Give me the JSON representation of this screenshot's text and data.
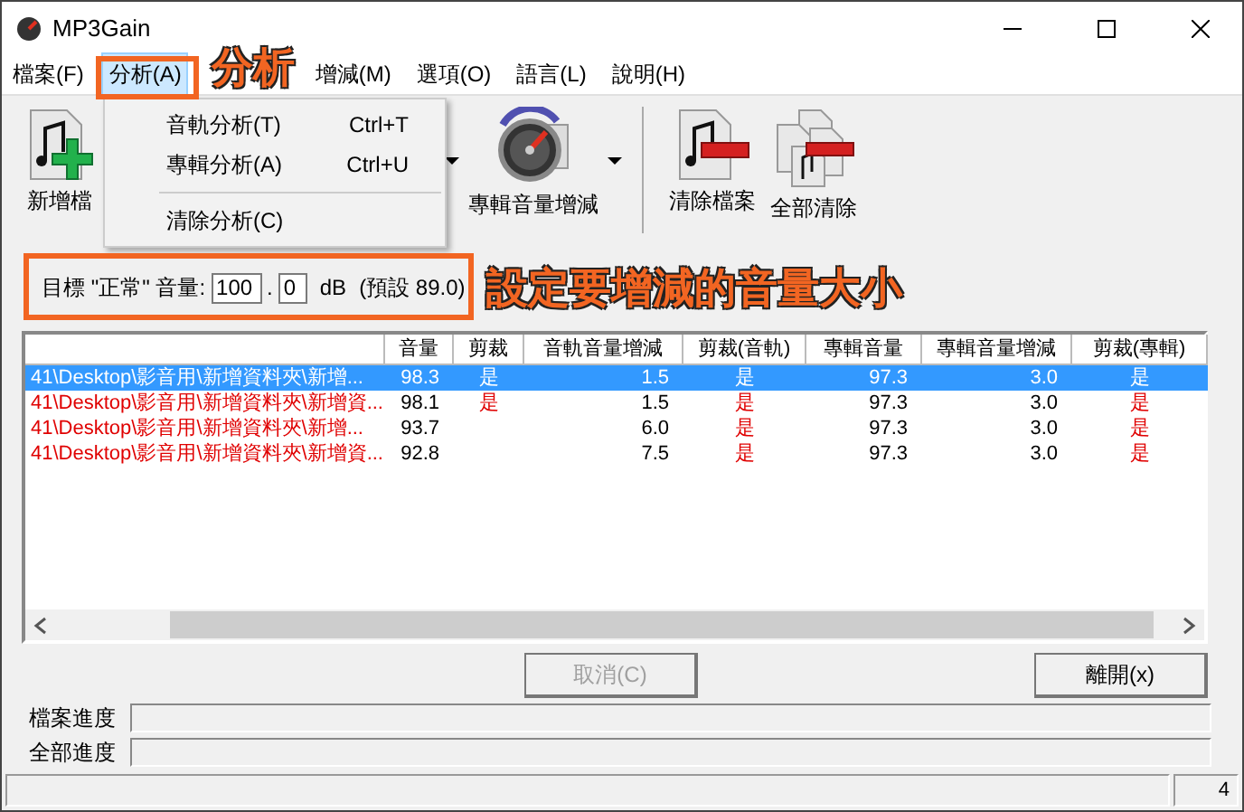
{
  "window": {
    "title": "MP3Gain"
  },
  "menu": [
    {
      "label": "檔案(F)",
      "selected": false
    },
    {
      "label": "分析(A)",
      "selected": true
    },
    {
      "label": "增減(M)",
      "selected": false
    },
    {
      "label": "選項(O)",
      "selected": false
    },
    {
      "label": "語言(L)",
      "selected": false
    },
    {
      "label": "說明(H)",
      "selected": false
    }
  ],
  "analysis_menu": [
    {
      "kind": "item",
      "label": "音軌分析(T)",
      "shortcut": "Ctrl+T"
    },
    {
      "kind": "item",
      "label": "專輯分析(A)",
      "shortcut": "Ctrl+U"
    },
    {
      "kind": "separator"
    },
    {
      "kind": "item",
      "label": "清除分析(C)"
    }
  ],
  "toolbar": [
    {
      "kind": "button",
      "label": "新增檔"
    },
    {
      "kind": "arrow"
    },
    {
      "kind": "button",
      "label": "專輯音量增減"
    },
    {
      "kind": "arrow"
    },
    {
      "kind": "separator"
    },
    {
      "kind": "button",
      "label": "清除檔案"
    },
    {
      "kind": "button",
      "label": "全部清除"
    }
  ],
  "target": {
    "label": "目標 \"正常\" 音量:",
    "integer": "100",
    "separator": ".",
    "decimal": "0",
    "unit": "dB",
    "default_note": "(預設 89.0)"
  },
  "table": {
    "columns": [
      "音量",
      "剪裁",
      "音軌音量增減",
      "剪裁(音軌)",
      "專輯音量",
      "專輯音量增減",
      "剪裁(專輯)"
    ],
    "rows": [
      {
        "selected": true,
        "path": "41\\Desktop\\影音用\\新增資料夾\\新增...",
        "volume": "98.3",
        "clip": "是",
        "track_gain": "1.5",
        "track_clip": "是",
        "album_volume": "97.3",
        "album_gain": "3.0",
        "album_clip": "是"
      },
      {
        "selected": false,
        "path": "41\\Desktop\\影音用\\新增資料夾\\新增資...",
        "volume": "98.1",
        "clip": "是",
        "track_gain": "1.5",
        "track_clip": "是",
        "album_volume": "97.3",
        "album_gain": "3.0",
        "album_clip": "是"
      },
      {
        "selected": false,
        "path": "41\\Desktop\\影音用\\新增資料夾\\新增...",
        "volume": "93.7",
        "track_gain": "6.0",
        "track_clip": "是",
        "album_volume": "97.3",
        "album_gain": "3.0",
        "album_clip": "是"
      },
      {
        "selected": false,
        "path": "41\\Desktop\\影音用\\新增資料夾\\新增資...",
        "volume": "92.8",
        "track_gain": "7.5",
        "track_clip": "是",
        "album_volume": "97.3",
        "album_gain": "3.0",
        "album_clip": "是"
      }
    ]
  },
  "buttons": [
    {
      "label": "取消(C)",
      "disabled": true
    },
    {
      "label": "離開(x)",
      "disabled": false
    }
  ],
  "progress": [
    {
      "label": "檔案進度",
      "level": 0
    },
    {
      "label": "全部進度",
      "level": 0
    }
  ],
  "status_bar": {
    "count": "4"
  },
  "annotations": [
    {
      "kind": "menu",
      "text": "分析"
    },
    {
      "kind": "target",
      "text": "設定要增減的音量大小"
    }
  ]
}
